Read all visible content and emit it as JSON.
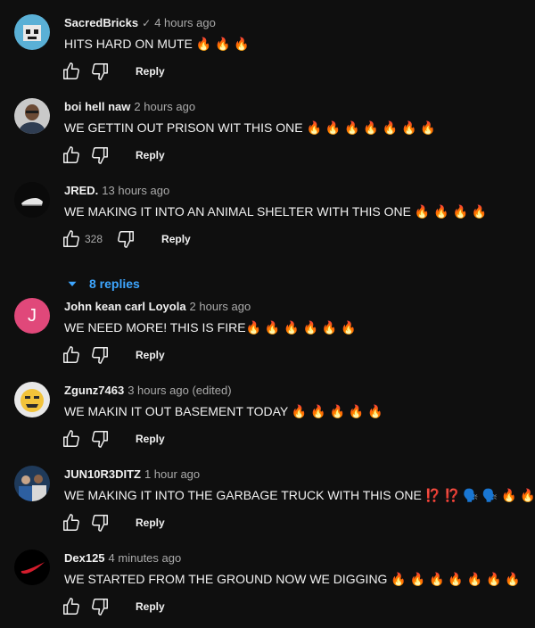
{
  "comments": [
    {
      "author": "SacredBricks",
      "verified": true,
      "time": "4 hours ago",
      "text": "HITS HARD ON MUTE 🔥 🔥 🔥",
      "likes": "",
      "reply": "Reply",
      "avatar": "skull-avatar",
      "avatar_bg": "#5ab0d6"
    },
    {
      "author": "boi hell naw",
      "verified": false,
      "time": "2 hours ago",
      "text": "WE GETTIN OUT PRISON WIT THIS ONE 🔥 🔥 🔥 🔥 🔥 🔥 🔥",
      "likes": "",
      "reply": "Reply",
      "avatar": "photo-avatar",
      "avatar_bg": "#c9c9c9"
    },
    {
      "author": "JRED.",
      "verified": false,
      "time": "13 hours ago",
      "text": "WE MAKING IT INTO AN ANIMAL SHELTER WITH THIS ONE 🔥 🔥 🔥 🔥",
      "likes": "328",
      "reply": "Reply",
      "replies": "8 replies",
      "avatar": "sneaker-avatar",
      "avatar_bg": "#0a0a0a"
    },
    {
      "author": "John kean carl Loyola",
      "verified": false,
      "time": "2 hours ago",
      "text": "WE NEED MORE! THIS IS FIRE🔥 🔥 🔥 🔥 🔥 🔥",
      "likes": "",
      "reply": "Reply",
      "avatar": "letter-avatar",
      "avatar_letter": "J",
      "avatar_bg": "#e0487a"
    },
    {
      "author": "Zgunz7463",
      "verified": false,
      "time": "3 hours ago (edited)",
      "text": "WE MAKIN IT OUT BASEMENT TODAY 🔥 🔥 🔥 🔥 🔥",
      "likes": "",
      "reply": "Reply",
      "avatar": "emoji-avatar",
      "avatar_bg": "#e8e8e8"
    },
    {
      "author": "JUN10R3DITZ",
      "verified": false,
      "time": "1 hour ago",
      "text": "WE MAKING IT INTO THE GARBAGE TRUCK WITH THIS ONE ⁉️ ⁉️ 🗣️ 🗣️ 🔥 🔥",
      "likes": "",
      "reply": "Reply",
      "avatar": "team-avatar",
      "avatar_bg": "#1f3a5a"
    },
    {
      "author": "Dex125",
      "verified": false,
      "time": "4 minutes ago",
      "text": "WE STARTED FROM THE GROUND NOW WE DIGGING 🔥 🔥 🔥 🔥 🔥 🔥 🔥",
      "likes": "",
      "reply": "Reply",
      "avatar": "swoosh-avatar",
      "avatar_bg": "#000000"
    }
  ],
  "colors": {
    "background": "#0f0f0f",
    "text": "#f1f1f1",
    "muted": "#aaaaaa",
    "link": "#3ea6ff"
  }
}
